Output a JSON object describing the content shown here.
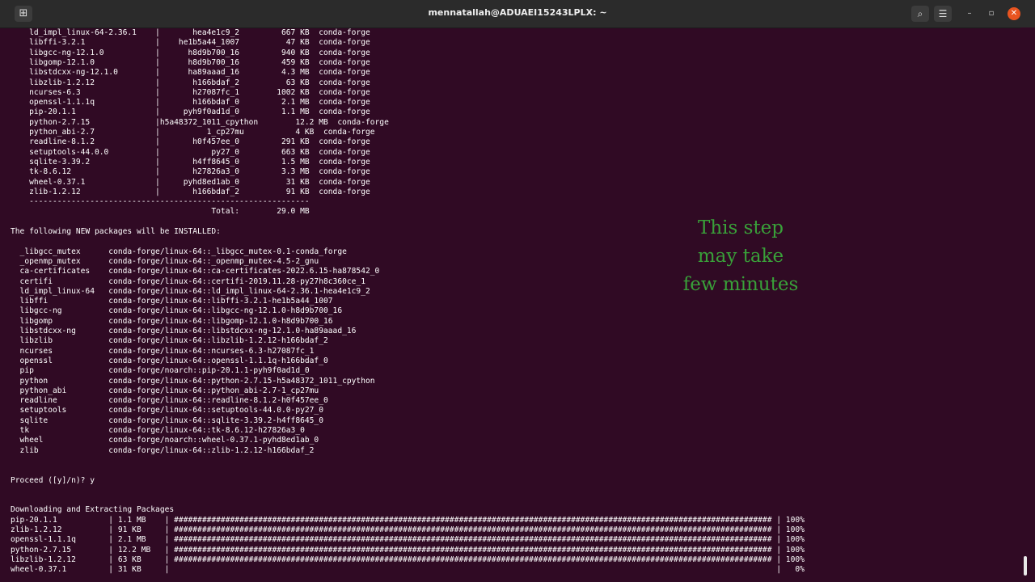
{
  "window": {
    "title": "mennatallah@ADUAEI15243LPLX: ~",
    "new_tab_glyph": "⊞",
    "search_glyph": "⌕",
    "menu_glyph": "☰",
    "minimize_glyph": "–",
    "maximize_glyph": "▫",
    "close_glyph": "✕",
    "colors": {
      "terminal_bg": "#300a24",
      "titlebar_bg": "#2b2b2b",
      "close_button": "#e95420",
      "overlay_text": "#39a039"
    }
  },
  "terminal": {
    "lines": [
      "    ld_impl_linux-64-2.36.1    |       hea4e1c9_2         667 KB  conda-forge",
      "    libffi-3.2.1               |    he1b5a44_1007          47 KB  conda-forge",
      "    libgcc-ng-12.1.0           |      h8d9b700_16         940 KB  conda-forge",
      "    libgomp-12.1.0             |      h8d9b700_16         459 KB  conda-forge",
      "    libstdcxx-ng-12.1.0        |      ha89aaad_16         4.3 MB  conda-forge",
      "    libzlib-1.2.12             |       h166bdaf_2          63 KB  conda-forge",
      "    ncurses-6.3                |       h27087fc_1        1002 KB  conda-forge",
      "    openssl-1.1.1q             |       h166bdaf_0         2.1 MB  conda-forge",
      "    pip-20.1.1                 |     pyh9f0ad1d_0         1.1 MB  conda-forge",
      "    python-2.7.15              |h5a48372_1011_cpython        12.2 MB  conda-forge",
      "    python_abi-2.7             |          1_cp27mu           4 KB  conda-forge",
      "    readline-8.1.2             |       h0f457ee_0         291 KB  conda-forge",
      "    setuptools-44.0.0          |           py27_0         663 KB  conda-forge",
      "    sqlite-3.39.2              |       h4ff8645_0         1.5 MB  conda-forge",
      "    tk-8.6.12                  |       h27826a3_0         3.3 MB  conda-forge",
      "    wheel-0.37.1               |     pyhd8ed1ab_0          31 KB  conda-forge",
      "    zlib-1.2.12                |       h166bdaf_2          91 KB  conda-forge",
      "    ------------------------------------------------------------",
      "                                           Total:        29.0 MB",
      "",
      "The following NEW packages will be INSTALLED:",
      "",
      "  _libgcc_mutex      conda-forge/linux-64::_libgcc_mutex-0.1-conda_forge",
      "  _openmp_mutex      conda-forge/linux-64::_openmp_mutex-4.5-2_gnu",
      "  ca-certificates    conda-forge/linux-64::ca-certificates-2022.6.15-ha878542_0",
      "  certifi            conda-forge/linux-64::certifi-2019.11.28-py27h8c360ce_1",
      "  ld_impl_linux-64   conda-forge/linux-64::ld_impl_linux-64-2.36.1-hea4e1c9_2",
      "  libffi             conda-forge/linux-64::libffi-3.2.1-he1b5a44_1007",
      "  libgcc-ng          conda-forge/linux-64::libgcc-ng-12.1.0-h8d9b700_16",
      "  libgomp            conda-forge/linux-64::libgomp-12.1.0-h8d9b700_16",
      "  libstdcxx-ng       conda-forge/linux-64::libstdcxx-ng-12.1.0-ha89aaad_16",
      "  libzlib            conda-forge/linux-64::libzlib-1.2.12-h166bdaf_2",
      "  ncurses            conda-forge/linux-64::ncurses-6.3-h27087fc_1",
      "  openssl            conda-forge/linux-64::openssl-1.1.1q-h166bdaf_0",
      "  pip                conda-forge/noarch::pip-20.1.1-pyh9f0ad1d_0",
      "  python             conda-forge/linux-64::python-2.7.15-h5a48372_1011_cpython",
      "  python_abi         conda-forge/linux-64::python_abi-2.7-1_cp27mu",
      "  readline           conda-forge/linux-64::readline-8.1.2-h0f457ee_0",
      "  setuptools         conda-forge/linux-64::setuptools-44.0.0-py27_0",
      "  sqlite             conda-forge/linux-64::sqlite-3.39.2-h4ff8645_0",
      "  tk                 conda-forge/linux-64::tk-8.6.12-h27826a3_0",
      "  wheel              conda-forge/noarch::wheel-0.37.1-pyhd8ed1ab_0",
      "  zlib               conda-forge/linux-64::zlib-1.2.12-h166bdaf_2",
      "",
      "",
      "Proceed ([y]/n)? y",
      "",
      "",
      "Downloading and Extracting Packages",
      "pip-20.1.1           | 1.1 MB    | ################################################################################################################################ | 100% ",
      "zlib-1.2.12          | 91 KB     | ################################################################################################################################ | 100% ",
      "openssl-1.1.1q       | 2.1 MB    | ################################################################################################################################ | 100% ",
      "python-2.7.15        | 12.2 MB   | ################################################################################################################################ | 100% ",
      "libzlib-1.2.12       | 63 KB     | ################################################################################################################################ | 100% ",
      "wheel-0.37.1         | 31 KB     |                                                                                                                                  |   0% "
    ]
  },
  "overlay": {
    "lines": [
      "This step",
      "may take",
      "few minutes"
    ]
  }
}
